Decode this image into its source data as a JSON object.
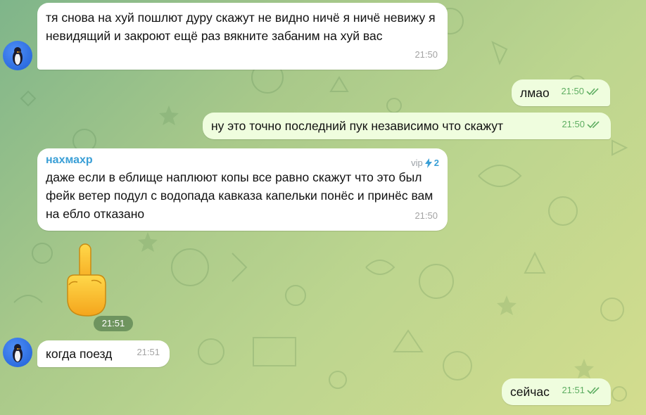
{
  "messages": [
    {
      "text": "тя снова на хуй пошлют дуру скажут не видно ничё я ничё невижу я невидящий и закроют ещё раз вякните забаним на хуй вас",
      "time": "21:50"
    },
    {
      "text": "лмао",
      "time": "21:50"
    },
    {
      "text": "ну это точно последний пук независимо что скажут",
      "time": "21:50"
    },
    {
      "sender": "нахмахр",
      "badge_label": "vip",
      "boost_count": "2",
      "text": "даже если в еблище наплюют копы все равно скажут что это был фейк ветер подул с водопада кавказа капельки понёс и принёс вам на ебло отказано",
      "time": "21:50"
    },
    {
      "sticker": "middle-finger-emoji",
      "time": "21:51"
    },
    {
      "text": "когда поезд",
      "time": "21:51"
    },
    {
      "text": "сейчас",
      "time": "21:51"
    }
  ],
  "colors": {
    "incoming": "#ffffff",
    "outgoing": "#effdde",
    "sender": "#3a9fd6",
    "check": "#5fae62"
  }
}
